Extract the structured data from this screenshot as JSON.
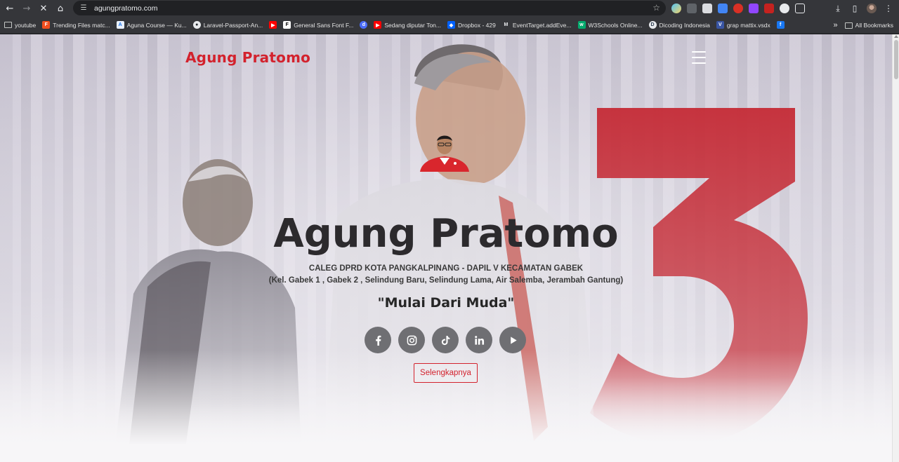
{
  "browser": {
    "url": "agungpratomo.com",
    "bookmarks": [
      {
        "label": "youtube",
        "icon": "folder-icon"
      },
      {
        "label": "Trending Files matc...",
        "icon": "figma-icon",
        "color": "#f24e1e"
      },
      {
        "label": "Aguna Course — Ku...",
        "icon": "site-icon",
        "color": "#e8f0fe"
      },
      {
        "label": "Laravel-Passport-An...",
        "icon": "github-icon",
        "color": "#24292e"
      },
      {
        "label": "",
        "icon": "youtube-icon",
        "color": "#ff0000"
      },
      {
        "label": "General Sans Font F...",
        "icon": "font-icon",
        "color": "#ffffff"
      },
      {
        "label": "",
        "icon": "d-icon",
        "color": "#4a6cf7"
      },
      {
        "label": "Sedang diputar Ton...",
        "icon": "youtube-icon",
        "color": "#ff0000"
      },
      {
        "label": "Dropbox - 429",
        "icon": "dropbox-icon",
        "color": "#0061ff"
      },
      {
        "label": "EventTarget.addEve...",
        "icon": "mdn-icon",
        "color": "#35363a"
      },
      {
        "label": "W3Schools Online...",
        "icon": "w3schools-icon",
        "color": "#04aa6d"
      },
      {
        "label": "Dicoding Indonesia",
        "icon": "dicoding-icon",
        "color": "#2d3e50"
      },
      {
        "label": "grap mattix.vsdx",
        "icon": "visio-icon",
        "color": "#3955a3"
      },
      {
        "label": "",
        "icon": "facebook-icon",
        "color": "#1877f2"
      }
    ],
    "all_bookmarks": "All Bookmarks"
  },
  "site": {
    "brand": "Agung Pratomo",
    "hero_title": "Agung Pratomo",
    "subtitle_line1": "CALEG DPRD KOTA PANGKALPINANG - DAPIL V KECAMATAN GABEK",
    "subtitle_line2": "(Kel. Gabek 1 , Gabek 2 , Selindung Baru, Selindung Lama, Air Salemba, Jerambah Gantung)",
    "slogan": "\"Mulai Dari Muda\"",
    "more_button": "Selengkapnya",
    "background_number": "3",
    "socials": [
      "facebook-icon",
      "instagram-icon",
      "tiktok-icon",
      "linkedin-icon",
      "youtube-play-icon"
    ]
  },
  "colors": {
    "brand_red": "#d3222d",
    "social_bg": "#6f6f73",
    "title_dark": "#2c2a2d"
  }
}
